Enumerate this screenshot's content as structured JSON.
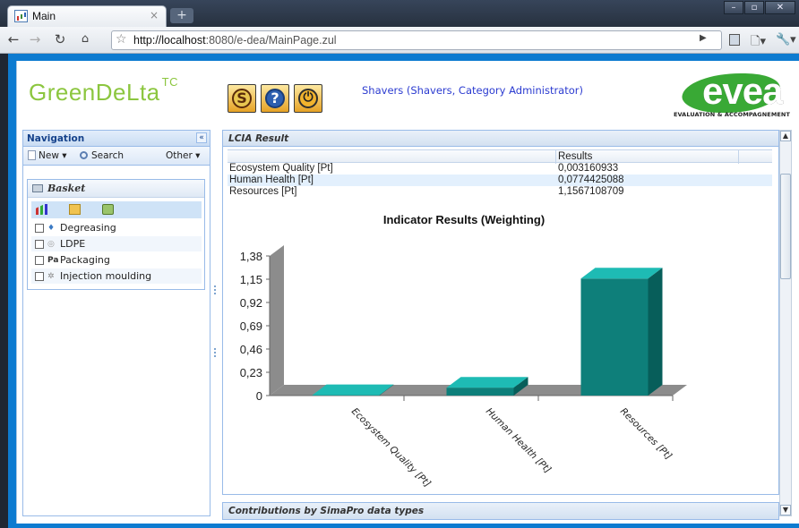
{
  "browser": {
    "tab_title": "Main",
    "tab_close": "×",
    "new_tab": "+",
    "window_buttons": [
      "–",
      "▫",
      "✕"
    ],
    "url_host": "http://localhost",
    "url_path": ":8080/e-dea/MainPage.zul"
  },
  "header": {
    "brand_left": "GreenDeLta",
    "brand_left_sup": "TC",
    "user": "Shavers (Shavers, Category Administrator)",
    "brand_right": "evea",
    "brand_right_tagline": "EVALUATION & ACCOMPAGNEMENT",
    "buttons": [
      "S",
      "?",
      "⏻"
    ]
  },
  "navigation": {
    "title": "Navigation",
    "collapse": "«",
    "menu": {
      "new": "New ▾",
      "search": "Search",
      "other": "Other ▾"
    },
    "basket": {
      "title": "Basket",
      "items": [
        {
          "label": "Degreasing",
          "icon": "wrench-icon"
        },
        {
          "label": "LDPE",
          "icon": "material-icon"
        },
        {
          "label": "Packaging",
          "icon": "packaging-icon"
        },
        {
          "label": "Injection moulding",
          "icon": "gear-icon"
        }
      ]
    }
  },
  "result": {
    "title": "LCIA Result",
    "columns": [
      "",
      "Results"
    ],
    "rows": [
      {
        "name": "Ecosystem Quality [Pt]",
        "value": "0,003160933"
      },
      {
        "name": "Human Health [Pt]",
        "value": "0,0774425088"
      },
      {
        "name": "Resources [Pt]",
        "value": "1,1567108709"
      }
    ]
  },
  "contributions_title": "Contributions by SimaPro data types",
  "colors": {
    "bar": "#0e7f7a",
    "bar_top": "#1ebbb4",
    "floor": "#8c8c8c",
    "brand_green": "#8cc63f"
  },
  "chart_data": {
    "type": "bar",
    "title": "Indicator Results (Weighting)",
    "categories": [
      "Ecosystem Quality [Pt]",
      "Human Health [Pt]",
      "Resources [Pt]"
    ],
    "values": [
      0.003160933,
      0.0774425088,
      1.1567108709
    ],
    "yticks": [
      "0",
      "0,23",
      "0,46",
      "0,69",
      "0,92",
      "1,15",
      "1,38"
    ],
    "ylim": [
      0,
      1.38
    ],
    "grid": false,
    "style": "3d"
  }
}
